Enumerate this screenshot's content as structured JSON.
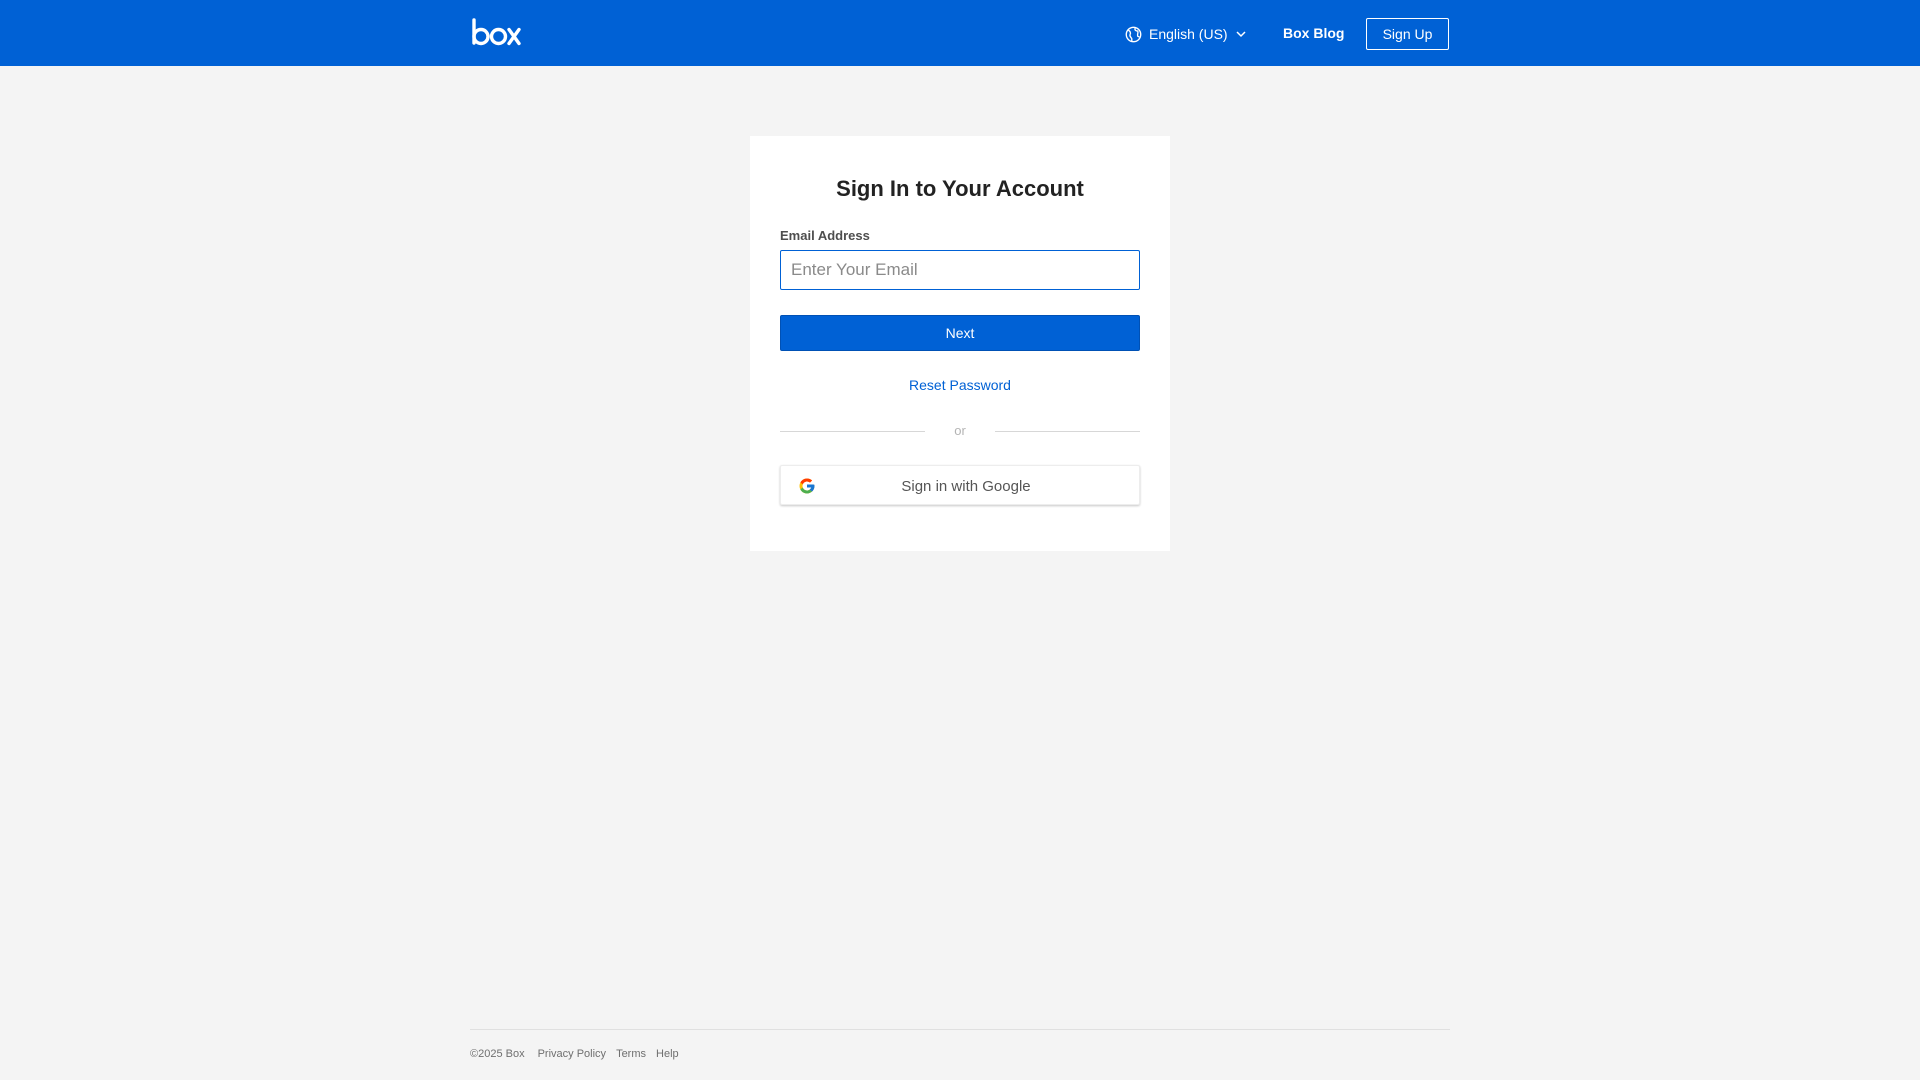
{
  "header": {
    "logo_text": "box",
    "logo_icon": "box-logo",
    "language": {
      "icon": "globe-icon",
      "label": "English (US)",
      "chevron": "chevron-down-icon"
    },
    "blog_label": "Box Blog",
    "signup_label": "Sign Up"
  },
  "signin": {
    "title": "Sign In to Your Account",
    "email_label": "Email Address",
    "email_placeholder": "Enter Your Email",
    "email_value": "",
    "next_label": "Next",
    "reset_label": "Reset Password",
    "divider_text": "or",
    "google_label": "Sign in with Google",
    "google_icon": "google-icon"
  },
  "footer": {
    "copyright": "©2025 Box",
    "links": [
      "Privacy Policy",
      "Terms",
      "Help"
    ]
  },
  "colors": {
    "brand_blue": "#0061d5",
    "page_background": "#f4f4f4",
    "card_background": "#ffffff"
  }
}
